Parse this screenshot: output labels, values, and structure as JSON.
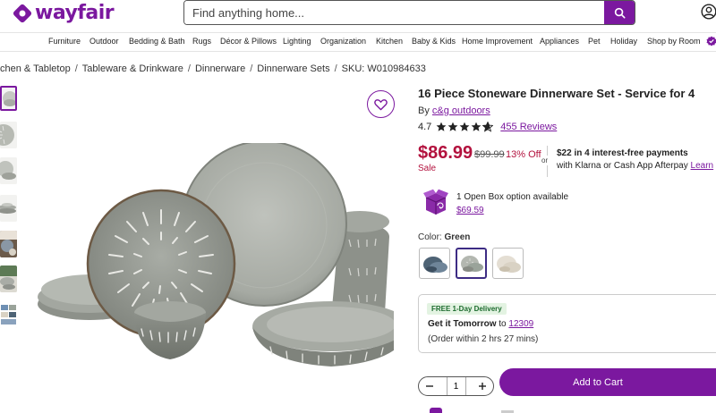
{
  "header": {
    "logo_text": "wayfair",
    "search_placeholder": "Find anything home...",
    "brand_color": "#7b189f",
    "icons": [
      "logo-icon",
      "search-icon",
      "account-icon"
    ]
  },
  "nav": {
    "items": [
      "Furniture",
      "Outdoor",
      "Bedding & Bath",
      "Rugs",
      "Décor & Pillows",
      "Lighting",
      "Organization",
      "Kitchen",
      "Baby & Kids",
      "Home Improvement",
      "Appliances",
      "Pet",
      "Holiday",
      "Shop by Room"
    ]
  },
  "breadcrumb": {
    "items": [
      "chen & Tabletop",
      "Tableware & Drinkware",
      "Dinnerware",
      "Dinnerware Sets",
      "SKU: W010984633"
    ],
    "separator": "/"
  },
  "product": {
    "title": "16 Piece Stoneware Dinnerware Set - Service for 4",
    "by_prefix": "By",
    "brand": "c&g outdoors",
    "rating": "4.7",
    "stars": 4.7,
    "reviews": "455 Reviews",
    "price": "$86.99",
    "was_price": "$99.99",
    "discount": "13% Off",
    "sale_label": "Sale",
    "sale_color": "#b3123e",
    "or_label": "or",
    "installments_bold": "$22 in 4 interest-free payments",
    "installments_text": "with Klarna or Cash App Afterpay",
    "installments_link": "Learn",
    "open_box_text": "1 Open Box option available",
    "open_box_price": "$69.59",
    "color_prefix": "Color:",
    "color_selected": "Green",
    "swatches": [
      {
        "name": "Blue",
        "color": "#4e6375"
      },
      {
        "name": "Green",
        "color": "#9aa39a"
      },
      {
        "name": "Beige",
        "color": "#d9d2c4"
      }
    ]
  },
  "delivery": {
    "badge": "FREE 1-Day Delivery",
    "get_it": "Get it Tomorrow",
    "to": "to",
    "zip": "12309",
    "order_within": "(Order within 2 hrs 27 mins)",
    "badge_color": "#1c6b2e"
  },
  "cart": {
    "quantity": "1",
    "add_label": "Add to Cart"
  }
}
